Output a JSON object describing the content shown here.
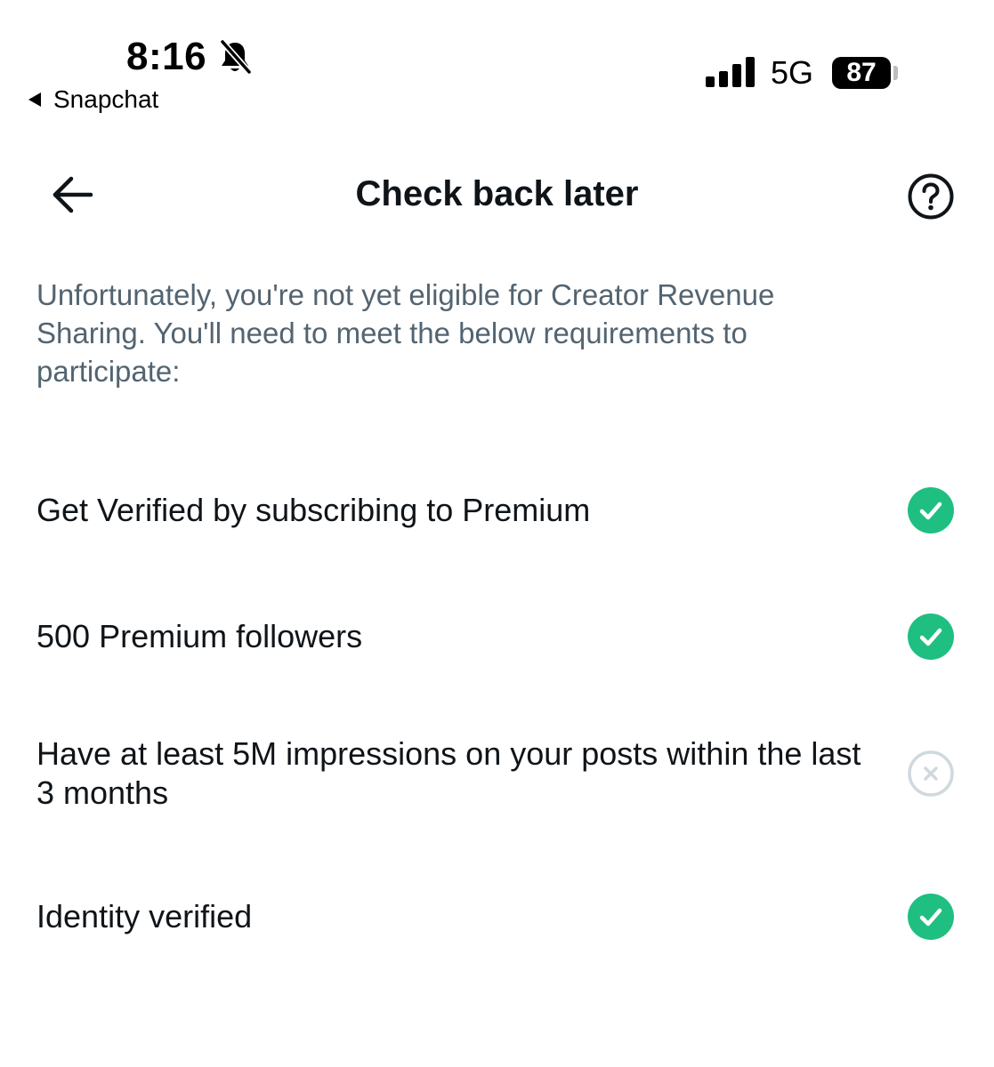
{
  "status_bar": {
    "time": "8:16",
    "back_app": "Snapchat",
    "network": "5G",
    "battery": "87"
  },
  "header": {
    "title": "Check back later"
  },
  "intro": "Unfortunately, you're not yet eligible for Creator Revenue Sharing. You'll need to meet the below requirements to participate:",
  "requirements": [
    {
      "label": "Get Verified by subscribing to Premium",
      "status": "met"
    },
    {
      "label": "500 Premium followers",
      "status": "met"
    },
    {
      "label": "Have at least 5M impressions on your posts within the last 3 months",
      "status": "not-met"
    },
    {
      "label": "Identity verified",
      "status": "met"
    }
  ],
  "colors": {
    "met": "#1fbf82",
    "not_met": "#cfd9de",
    "secondary_text": "#536471",
    "primary_text": "#0f1419"
  }
}
